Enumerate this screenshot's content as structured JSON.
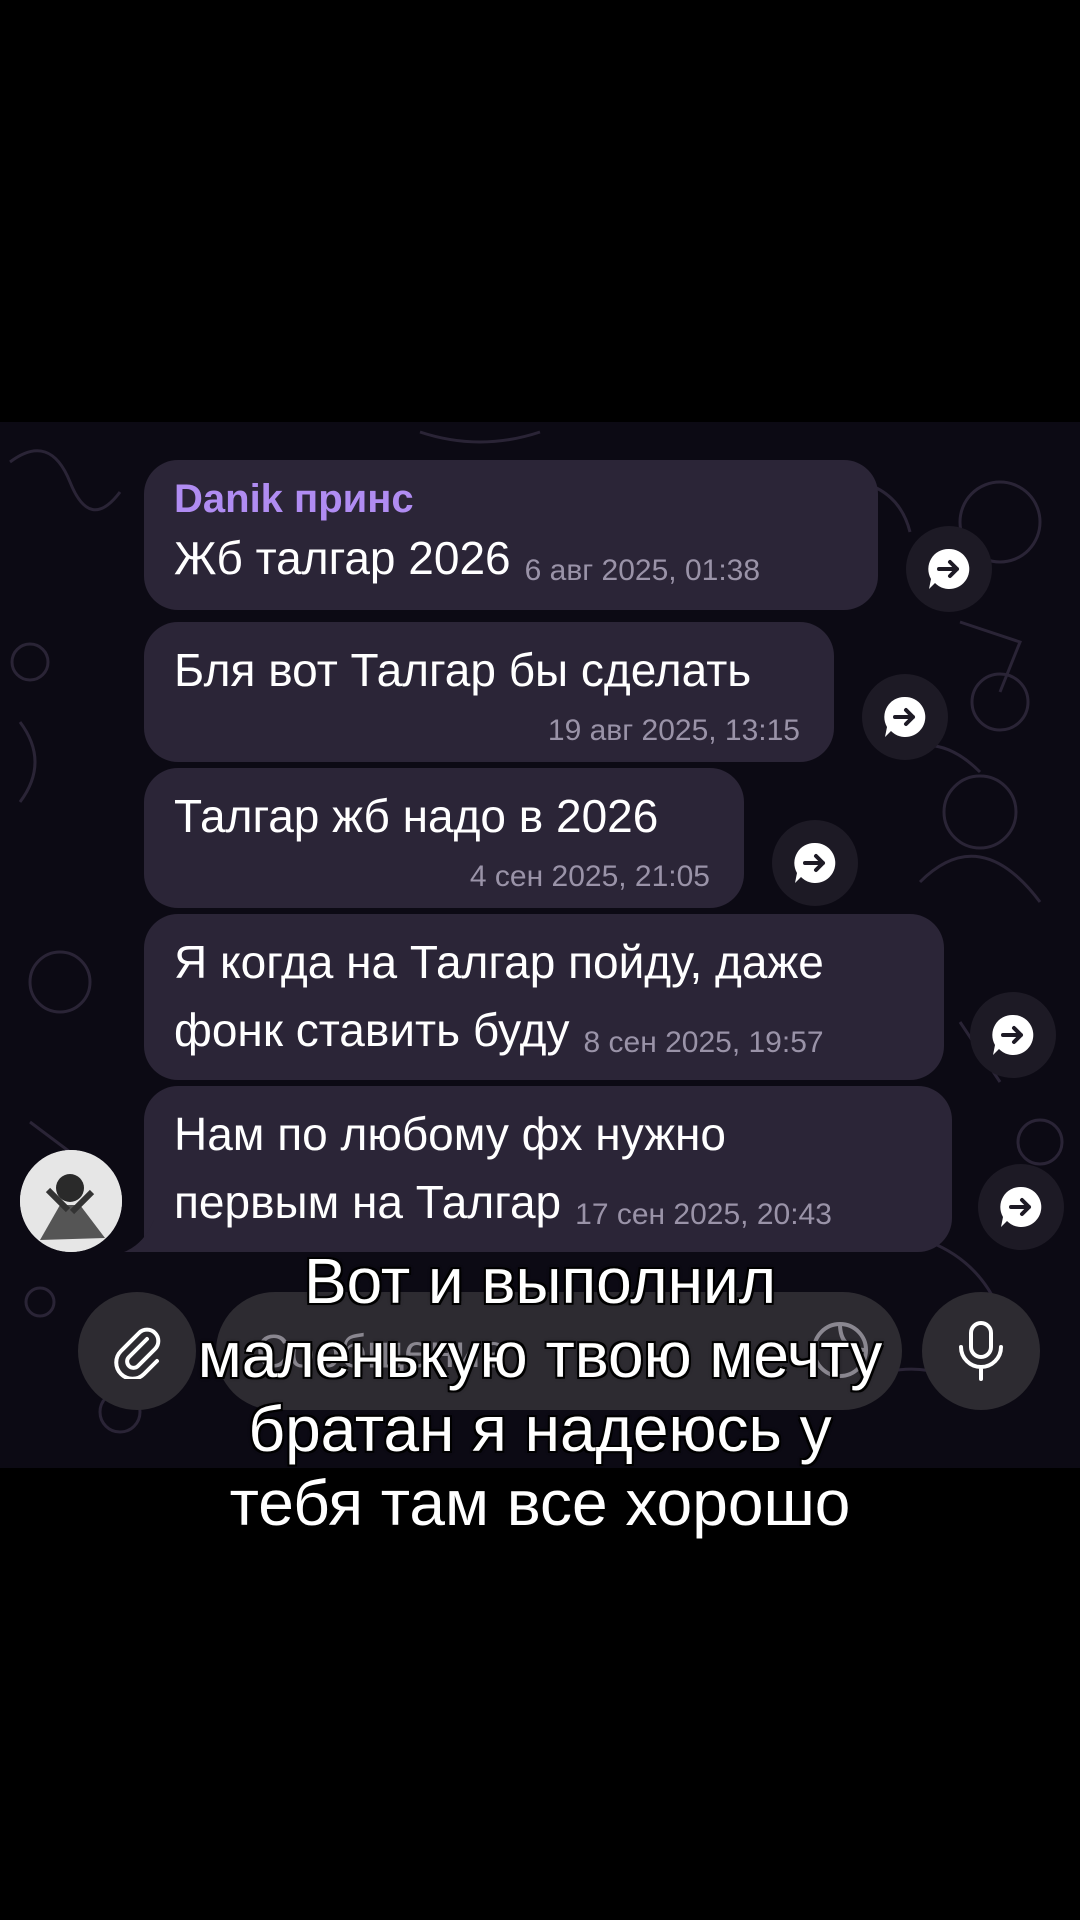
{
  "messages": [
    {
      "sender": "Danik принс",
      "text": "Жб талгар 2026",
      "time": "6 авг 2025, 01:38"
    },
    {
      "text": "Бля вот Талгар бы сделать",
      "time": "19 авг 2025, 13:15"
    },
    {
      "text": "Талгар жб надо в 2026",
      "time": "4 сен 2025, 21:05"
    },
    {
      "line1": "Я когда на Талгар пойду, даже",
      "line2": "фонк ставить буду",
      "time": "8 сен 2025, 19:57"
    },
    {
      "line1": "Нам по любому фх нужно",
      "line2": "первым на Талгар",
      "time": "17 сен 2025, 20:43"
    }
  ],
  "input": {
    "placeholder": "Сообщение"
  },
  "caption": [
    "Вот и выполнил",
    "маленькую твою мечту",
    "братан я надеюсь у",
    "тебя там все хорошо"
  ],
  "icons": {
    "forward": "forward-arrow-icon",
    "attach": "paperclip-icon",
    "emoji": "sticker-icon",
    "mic": "microphone-icon"
  },
  "colors": {
    "bubble": "#2b2537",
    "sender": "#b08cf2",
    "background": "#0c0a14"
  }
}
